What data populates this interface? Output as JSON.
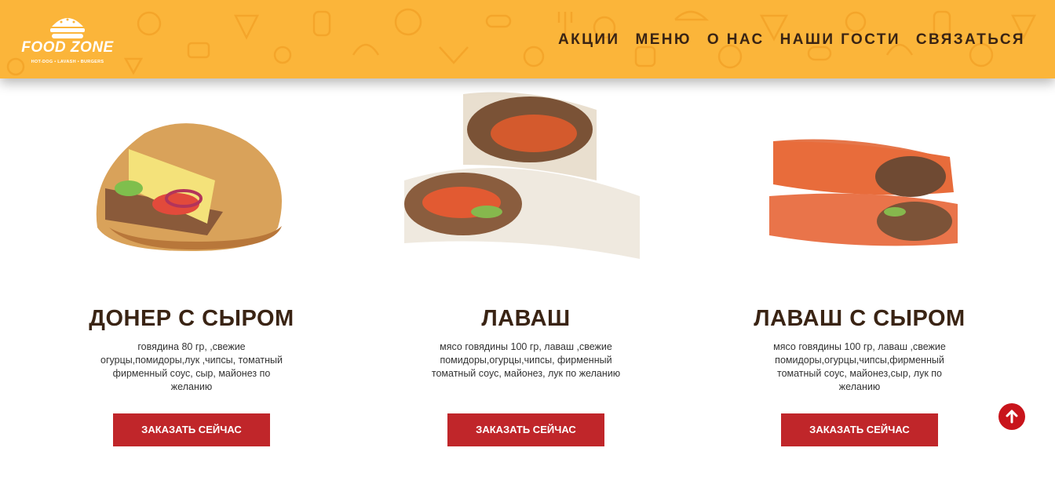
{
  "header": {
    "logo": {
      "name": "FOOD ZONE",
      "tagline": "HOT-DOG • LAVASH • BURGERS"
    },
    "nav": [
      "АКЦИИ",
      "МЕНЮ",
      "О НАС",
      "НАШИ ГОСТИ",
      "СВЯЗАТЬСЯ"
    ]
  },
  "products": [
    {
      "title": "ДОНЕР С СЫРОМ",
      "description": "говядина 80 гр, ,свежие огурцы,помидоры,лук ,чипсы, томатный фирменный соус, сыр, майонез по желанию",
      "button": "ЗАКАЗАТЬ СЕЙЧАС",
      "image": "doner-with-cheese-photo"
    },
    {
      "title": "ЛАВАШ",
      "description": "мясо говядины 100 гр, лаваш ,свежие помидоры,огурцы,чипсы, фирменный томатный соус, майонез, лук по желанию",
      "button": "ЗАКАЗАТЬ СЕЙЧАС",
      "image": "lavash-photo"
    },
    {
      "title": "ЛАВАШ С СЫРОМ",
      "description": "мясо говядины 100 гр, лаваш ,свежие помидоры,огурцы,чипсы,фирменный томатный соус, майонез,сыр, лук по желанию",
      "button": "ЗАКАЗАТЬ СЕЙЧАС",
      "image": "lavash-with-cheese-photo"
    }
  ],
  "scroll_top": {
    "icon": "arrow-up-icon"
  },
  "colors": {
    "header_bg": "#fbb53a",
    "button_bg": "#c0262a",
    "title": "#3a2414",
    "scroll_top_bg": "#c8141b"
  }
}
